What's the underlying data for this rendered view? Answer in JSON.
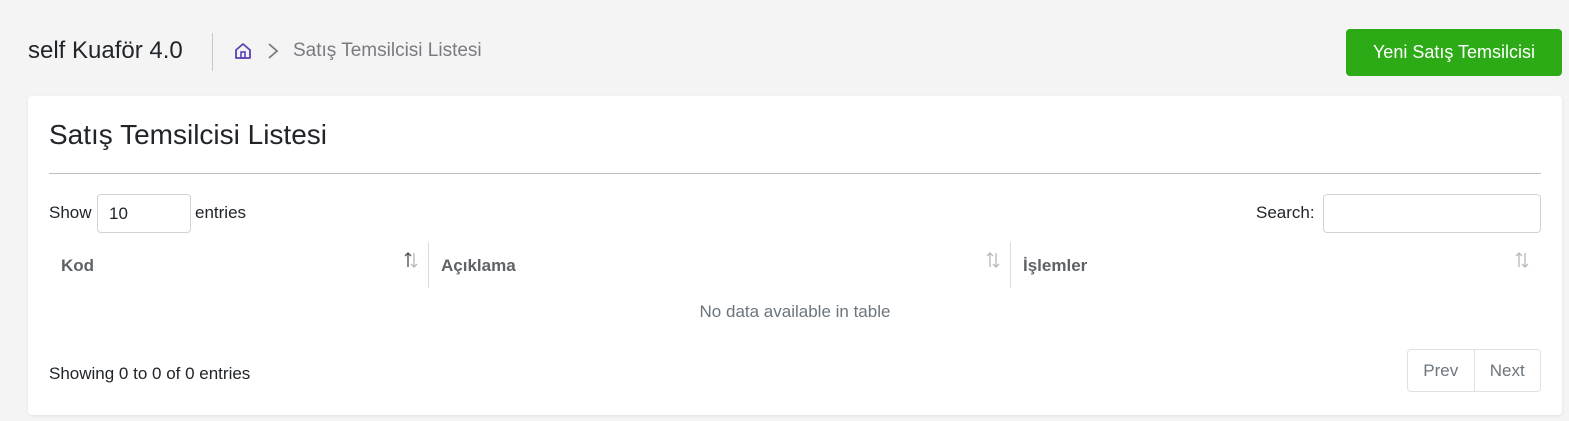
{
  "header": {
    "app_title": "self Kuaför 4.0",
    "breadcrumb_current": "Satış Temsilcisi Listesi",
    "new_button_label": "Yeni Satış Temsilcisi"
  },
  "card": {
    "title": "Satış Temsilcisi Listesi",
    "length": {
      "show_label": "Show",
      "value": "10",
      "entries_label": "entries"
    },
    "search": {
      "label": "Search:",
      "value": ""
    },
    "table": {
      "columns": [
        "Kod",
        "Açıklama",
        "İşlemler"
      ],
      "empty_message": "No data available in table"
    },
    "info": "Showing 0 to 0 of 0 entries",
    "pagination": {
      "prev_label": "Prev",
      "next_label": "Next"
    }
  },
  "colors": {
    "accent_green": "#2cab17",
    "home_icon": "#5b3fb5",
    "background": "#f4f4f5"
  },
  "icons": {
    "home": "home-icon",
    "breadcrumb_separator": "chevron-right-icon",
    "sort": "sort-both-icon"
  }
}
